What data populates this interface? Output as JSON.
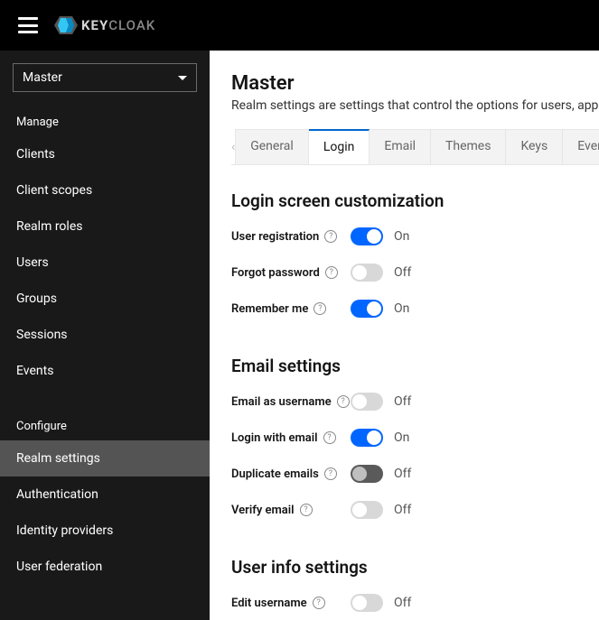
{
  "topbar": {
    "brand_strong": "KEY",
    "brand_light": "CLOAK"
  },
  "sidebar": {
    "realm_selected": "Master",
    "groups": [
      {
        "label": "Manage",
        "items": [
          {
            "label": "Clients"
          },
          {
            "label": "Client scopes"
          },
          {
            "label": "Realm roles"
          },
          {
            "label": "Users"
          },
          {
            "label": "Groups"
          },
          {
            "label": "Sessions"
          },
          {
            "label": "Events"
          }
        ]
      },
      {
        "label": "Configure",
        "items": [
          {
            "label": "Realm settings",
            "active": true
          },
          {
            "label": "Authentication"
          },
          {
            "label": "Identity providers"
          },
          {
            "label": "User federation"
          }
        ]
      }
    ]
  },
  "page": {
    "title": "Master",
    "subtitle": "Realm settings are settings that control the options for users, application"
  },
  "tabs": {
    "items": [
      {
        "label": "General"
      },
      {
        "label": "Login",
        "active": true
      },
      {
        "label": "Email"
      },
      {
        "label": "Themes"
      },
      {
        "label": "Keys"
      },
      {
        "label": "Events"
      }
    ]
  },
  "labels": {
    "on": "On",
    "off": "Off"
  },
  "sections": [
    {
      "title": "Login screen customization",
      "rows": [
        {
          "label": "User registration",
          "value": true
        },
        {
          "label": "Forgot password",
          "value": false
        },
        {
          "label": "Remember me",
          "value": true
        }
      ]
    },
    {
      "title": "Email settings",
      "rows": [
        {
          "label": "Email as username",
          "value": false
        },
        {
          "label": "Login with email",
          "value": true
        },
        {
          "label": "Duplicate emails",
          "value": false,
          "disabled": true
        },
        {
          "label": "Verify email",
          "value": false
        }
      ]
    },
    {
      "title": "User info settings",
      "rows": [
        {
          "label": "Edit username",
          "value": false
        }
      ]
    }
  ]
}
